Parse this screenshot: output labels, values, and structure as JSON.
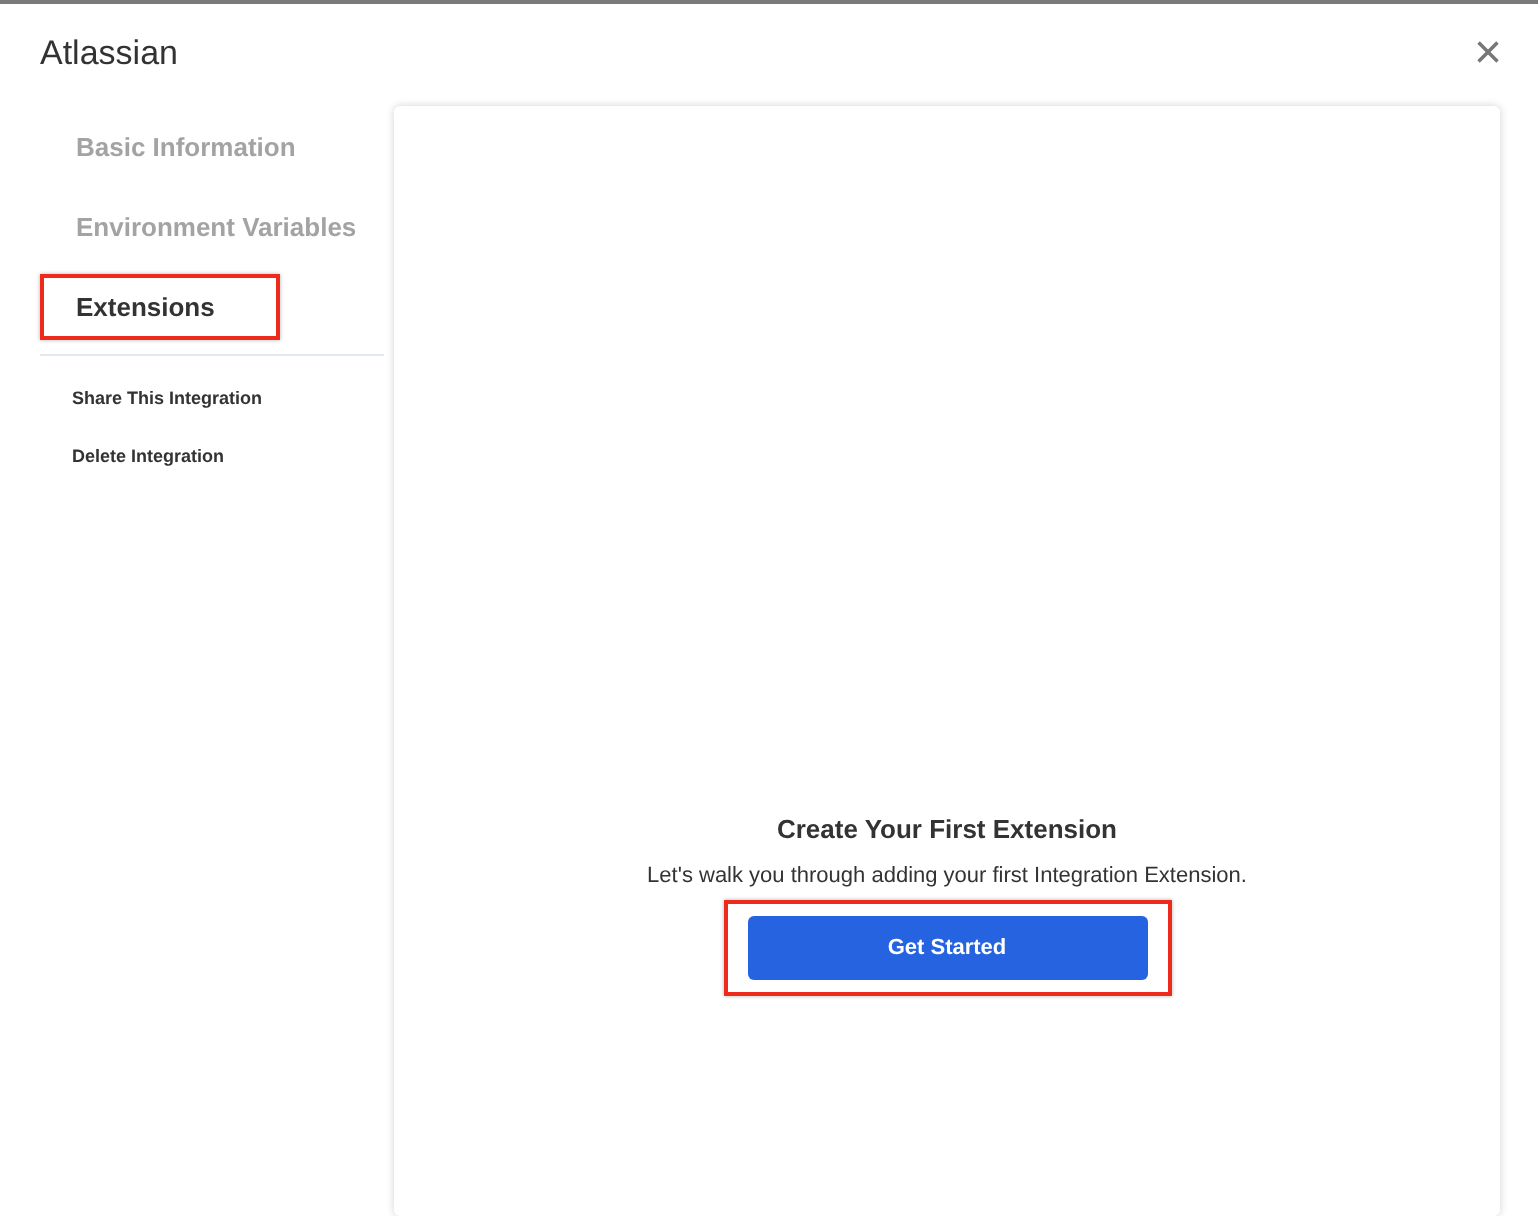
{
  "window": {
    "title": "Atlassian",
    "close": "×"
  },
  "sidebar": {
    "items": [
      {
        "label": "Basic Information",
        "selected": false,
        "highlighted": false
      },
      {
        "label": "Environment Variables",
        "selected": false,
        "highlighted": false
      },
      {
        "label": "Extensions",
        "selected": true,
        "highlighted": true
      }
    ],
    "actions": [
      {
        "label": "Share This Integration"
      },
      {
        "label": "Delete Integration"
      }
    ]
  },
  "content": {
    "heading": "Create Your First Extension",
    "description": "Let's walk you through adding your first Integration Extension.",
    "button": {
      "label": "Get Started",
      "highlighted": true
    }
  }
}
